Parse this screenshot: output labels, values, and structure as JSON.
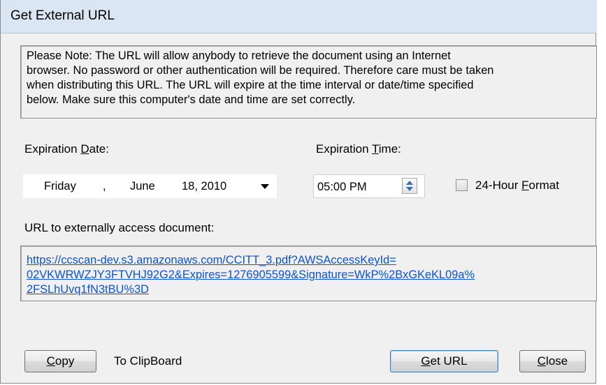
{
  "window": {
    "title": "Get External URL"
  },
  "note": {
    "lines": [
      "Please Note: The URL will allow anybody to retrieve the document using an Internet",
      "browser. No password or other authentication will be required. Therefore care must be taken",
      "when distributing this URL. The URL will expire at the time interval or date/time specified",
      "below. Make sure this computer's date and time are set correctly."
    ]
  },
  "expiration_date": {
    "label_pre": "Expiration ",
    "label_accel": "D",
    "label_post": "ate:",
    "weekday": "Friday",
    "separator": ",",
    "month": "June",
    "day_year": "18, 2010"
  },
  "expiration_time": {
    "label_pre": "Expiration ",
    "label_accel": "T",
    "label_post": "ime:",
    "value": "05:00 PM"
  },
  "format_24h": {
    "label_pre": "24-Hour ",
    "label_accel": "F",
    "label_post": "ormat",
    "checked": false
  },
  "url_section": {
    "label": "URL to externally access document:",
    "url_lines": [
      "https://ccscan-dev.s3.amazonaws.com/CCITT_3.pdf?AWSAccessKeyId=",
      "02VKWRWZJY3FTVHJ92G2&Expires=1276905599&Signature=WkP%2BxGKeKL09a%",
      "2FSLhUvq1fN3tBU%3D"
    ]
  },
  "buttons": {
    "copy": {
      "accel": "C",
      "rest": "opy"
    },
    "clipboard_label": "To ClipBoard",
    "get_url": {
      "accel": "G",
      "rest": "et URL"
    },
    "close": {
      "accel": "C",
      "rest": "lose"
    }
  },
  "colors": {
    "dialog_bg": "#f0f0f0",
    "titlebar_bg": "#dbe6f4",
    "link": "#0b53d6",
    "default_button_border": "#3c7fb1"
  },
  "icons": {
    "date_dropdown": "triangle-down",
    "time_spinner": "up-down-arrows"
  }
}
